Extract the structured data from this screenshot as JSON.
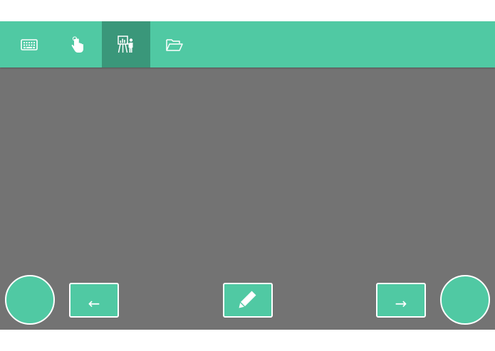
{
  "colors": {
    "accent": "#50c9a3",
    "accent_active": "#3a977a",
    "canvas": "#737373",
    "border": "#ffffff"
  },
  "toolbar": {
    "tabs": [
      {
        "icon": "keyboard-icon",
        "active": false
      },
      {
        "icon": "touch-hand-icon",
        "active": false
      },
      {
        "icon": "presentation-icon",
        "active": true
      },
      {
        "icon": "folder-open-icon",
        "active": false
      }
    ]
  },
  "controls": {
    "left_circle": {
      "icon": "none"
    },
    "prev_label": "←",
    "pen": {
      "icon": "pencil-icon"
    },
    "next_label": "→",
    "right_circle": {
      "icon": "none"
    }
  }
}
